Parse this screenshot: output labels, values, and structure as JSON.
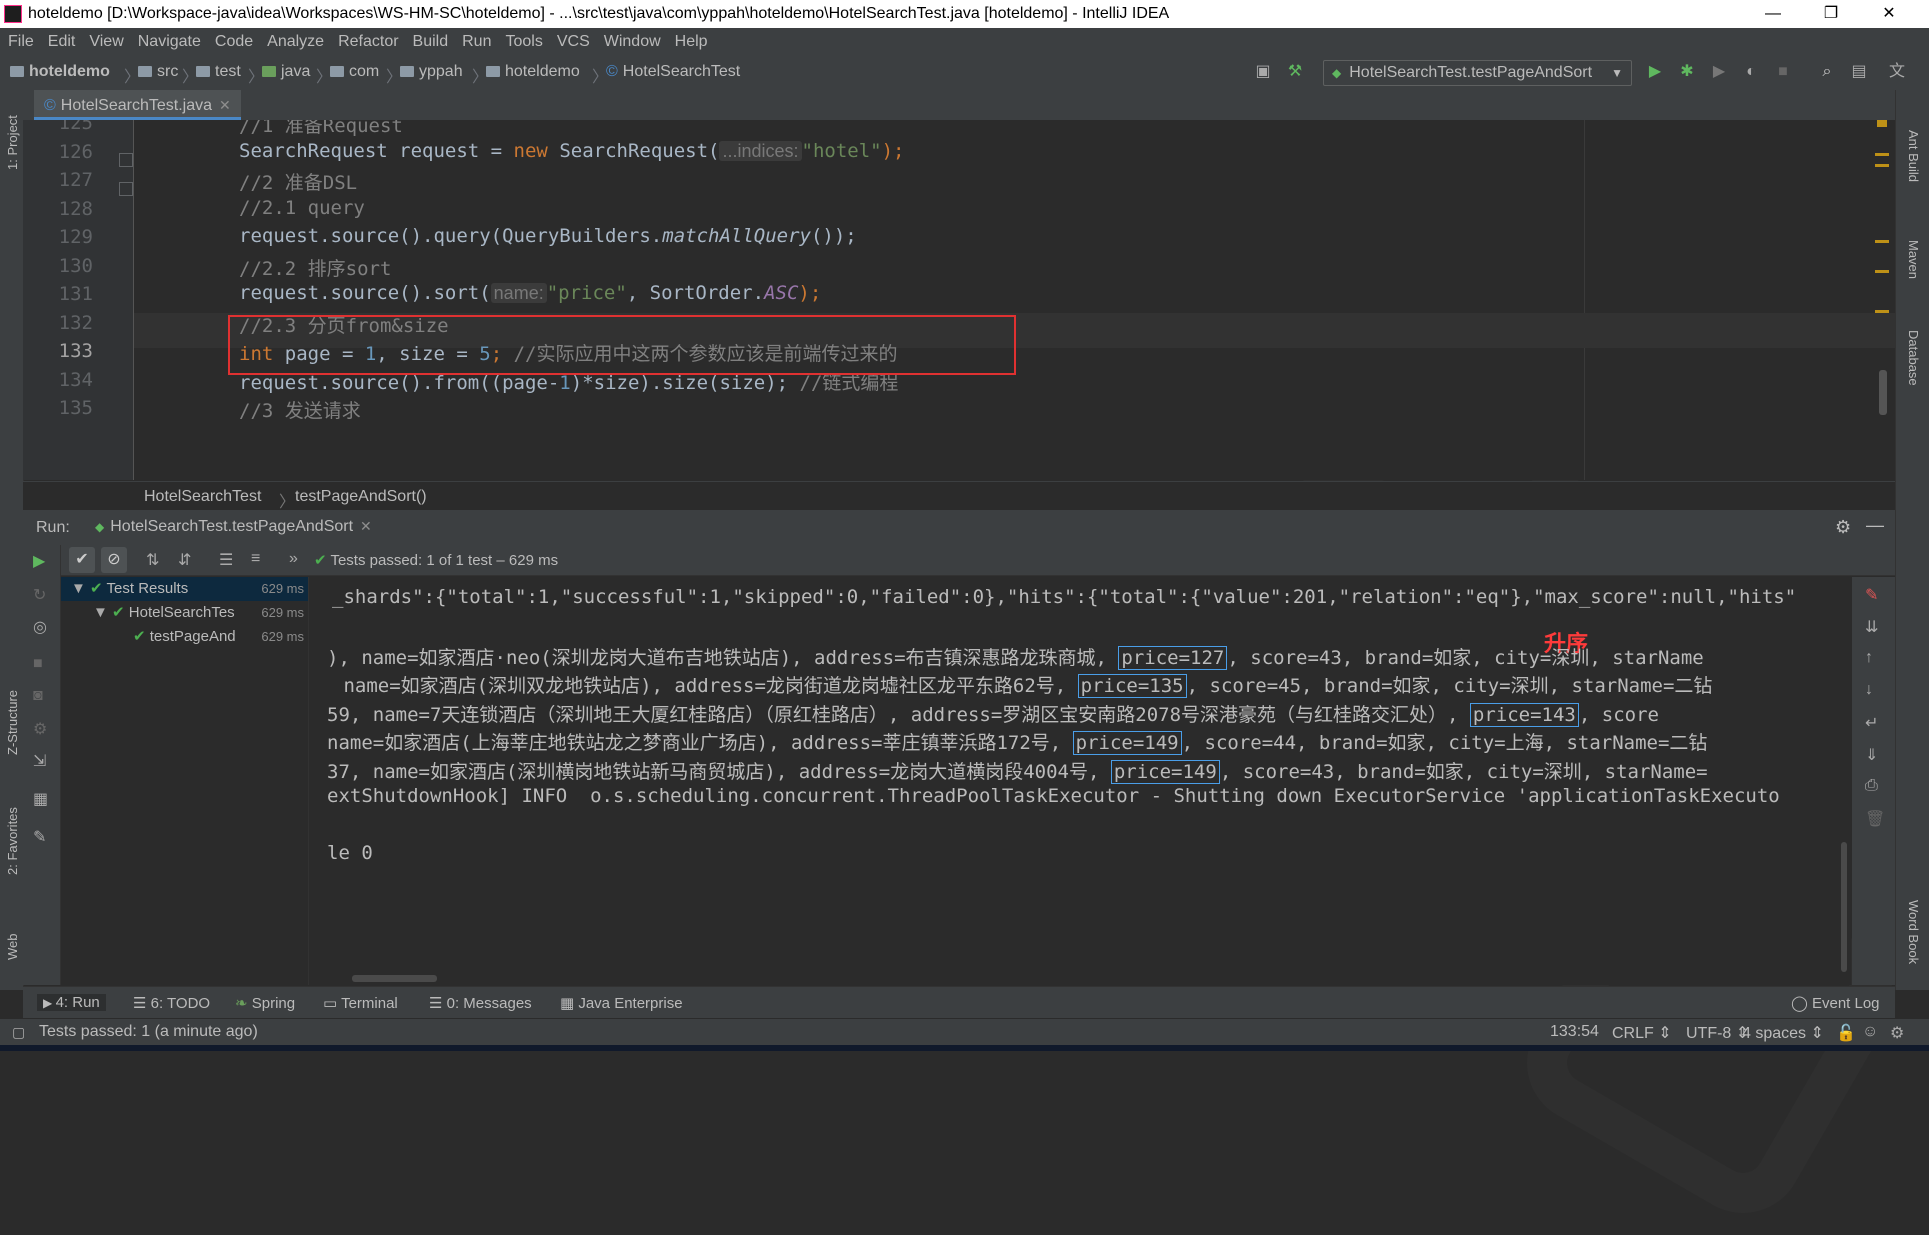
{
  "window": {
    "title": "hoteldemo [D:\\Workspace-java\\idea\\Workspaces\\WS-HM-SC\\hoteldemo] - ...\\src\\test\\java\\com\\yppah\\hoteldemo\\HotelSearchTest.java [hoteldemo] - IntelliJ IDEA",
    "minimize": "—",
    "maximize": "❐",
    "close": "✕"
  },
  "menu": [
    "File",
    "Edit",
    "View",
    "Navigate",
    "Code",
    "Analyze",
    "Refactor",
    "Build",
    "Run",
    "Tools",
    "VCS",
    "Window",
    "Help"
  ],
  "breadcrumbs": [
    "hoteldemo",
    "src",
    "test",
    "java",
    "com",
    "yppah",
    "hoteldemo",
    "HotelSearchTest"
  ],
  "run_config": "HotelSearchTest.testPageAndSort",
  "editor": {
    "tab_label": "HotelSearchTest.java",
    "line_numbers": [
      "125",
      "126",
      "127",
      "128",
      "129",
      "130",
      "131",
      "132",
      "133",
      "134",
      "135"
    ],
    "current_line": "133",
    "breadcrumb_class": "HotelSearchTest",
    "breadcrumb_method": "testPageAndSort()"
  },
  "code": {
    "l125": "//1 准备Request",
    "l126_a": "SearchRequest request = ",
    "l126_kw": "new",
    "l126_b": " SearchRequest(",
    "l126_hint": "...indices:",
    "l126_str": "\"hotel\"",
    "l126_c": ");",
    "l127": "//2 准备DSL",
    "l128": "//2.1 query",
    "l129_a": "request.source().query(QueryBuilders.",
    "l129_it": "matchAllQuery",
    "l129_b": "());",
    "l130": "//2.2 排序sort",
    "l131_a": "request.source().sort(",
    "l131_hint": "name:",
    "l131_str": "\"price\"",
    "l131_b": ", SortOrder.",
    "l131_it": "ASC",
    "l131_c": ");",
    "l132": "//2.3 分页from&size",
    "l133_kw": "int",
    "l133_a": " page = ",
    "l133_n1": "1",
    "l133_b": ", size = ",
    "l133_n2": "5",
    "l133_c": "; ",
    "l133_cm": "//实际应用中这两个参数应该是前端传过来的",
    "l134_a": "request.source().from((page-",
    "l134_n": "1",
    "l134_b": ")*size).size(size); ",
    "l134_cm": "//链式编程",
    "l135": "//3 发送请求"
  },
  "run": {
    "label": "Run:",
    "tab": "HotelSearchTest.testPageAndSort",
    "status": "Tests passed: 1 of 1 test – 629 ms",
    "tree": [
      {
        "label": "Test Results",
        "time": "629 ms"
      },
      {
        "label": "HotelSearchTes",
        "time": "629 ms"
      },
      {
        "label": "testPageAnd",
        "time": "629 ms"
      }
    ]
  },
  "console": {
    "line1": "_shards\":{\"total\":1,\"successful\":1,\"skipped\":0,\"failed\":0},\"hits\":{\"total\":{\"value\":201,\"relation\":\"eq\"},\"max_score\":null,\"hits\"",
    "annotation": "升序",
    "r1_a": "), name=如家酒店·neo(深圳龙岗大道布吉地铁站店), address=布吉镇深惠路龙珠商城, ",
    "r1_p": "price=127",
    "r1_b": ", score=43, brand=如家, city=深圳, starName",
    "r2_a": " name=如家酒店(深圳双龙地铁站店), address=龙岗街道龙岗墟社区龙平东路62号, ",
    "r2_p": "price=135",
    "r2_b": ", score=45, brand=如家, city=深圳, starName=二钻",
    "r3_a": "59, name=7天连锁酒店（深圳地王大厦红桂路店）（原红桂路店）, address=罗湖区宝安南路2078号深港豪苑（与红桂路交汇处）, ",
    "r3_p": "price=143",
    "r3_b": ", score",
    "r4_a": "name=如家酒店(上海莘庄地铁站龙之梦商业广场店), address=莘庄镇莘浜路172号, ",
    "r4_p": "price=149",
    "r4_b": ", score=44, brand=如家, city=上海, starName=二钻",
    "r5_a": "37, name=如家酒店(深圳横岗地铁站新马商贸城店), address=龙岗大道横岗段4004号, ",
    "r5_p": "price=149",
    "r5_b": ", score=43, brand=如家, city=深圳, starName=",
    "shutdown": "extShutdownHook] INFO  o.s.scheduling.concurrent.ThreadPoolTaskExecutor - Shutting down ExecutorService 'applicationTaskExecuto",
    "exit": "le 0"
  },
  "tool_tabs": [
    "4: Run",
    "6: TODO",
    "Spring",
    "Terminal",
    "0: Messages",
    "Java Enterprise"
  ],
  "event_log": "Event Log",
  "left_tools": [
    "1: Project",
    "Z-Structure",
    "2: Favorites",
    "Web"
  ],
  "right_tools": [
    "Ant Build",
    "Maven",
    "Database",
    "Word Book"
  ],
  "status": {
    "message": "Tests passed: 1 (a minute ago)",
    "position": "133:54",
    "line_sep": "CRLF",
    "encoding": "UTF-8",
    "indent": "4 spaces"
  },
  "colors": {
    "accent": "#4a88c7",
    "pass_green": "#4caf50",
    "highlight_red": "#e03131",
    "price_box": "#4a9ee8"
  }
}
